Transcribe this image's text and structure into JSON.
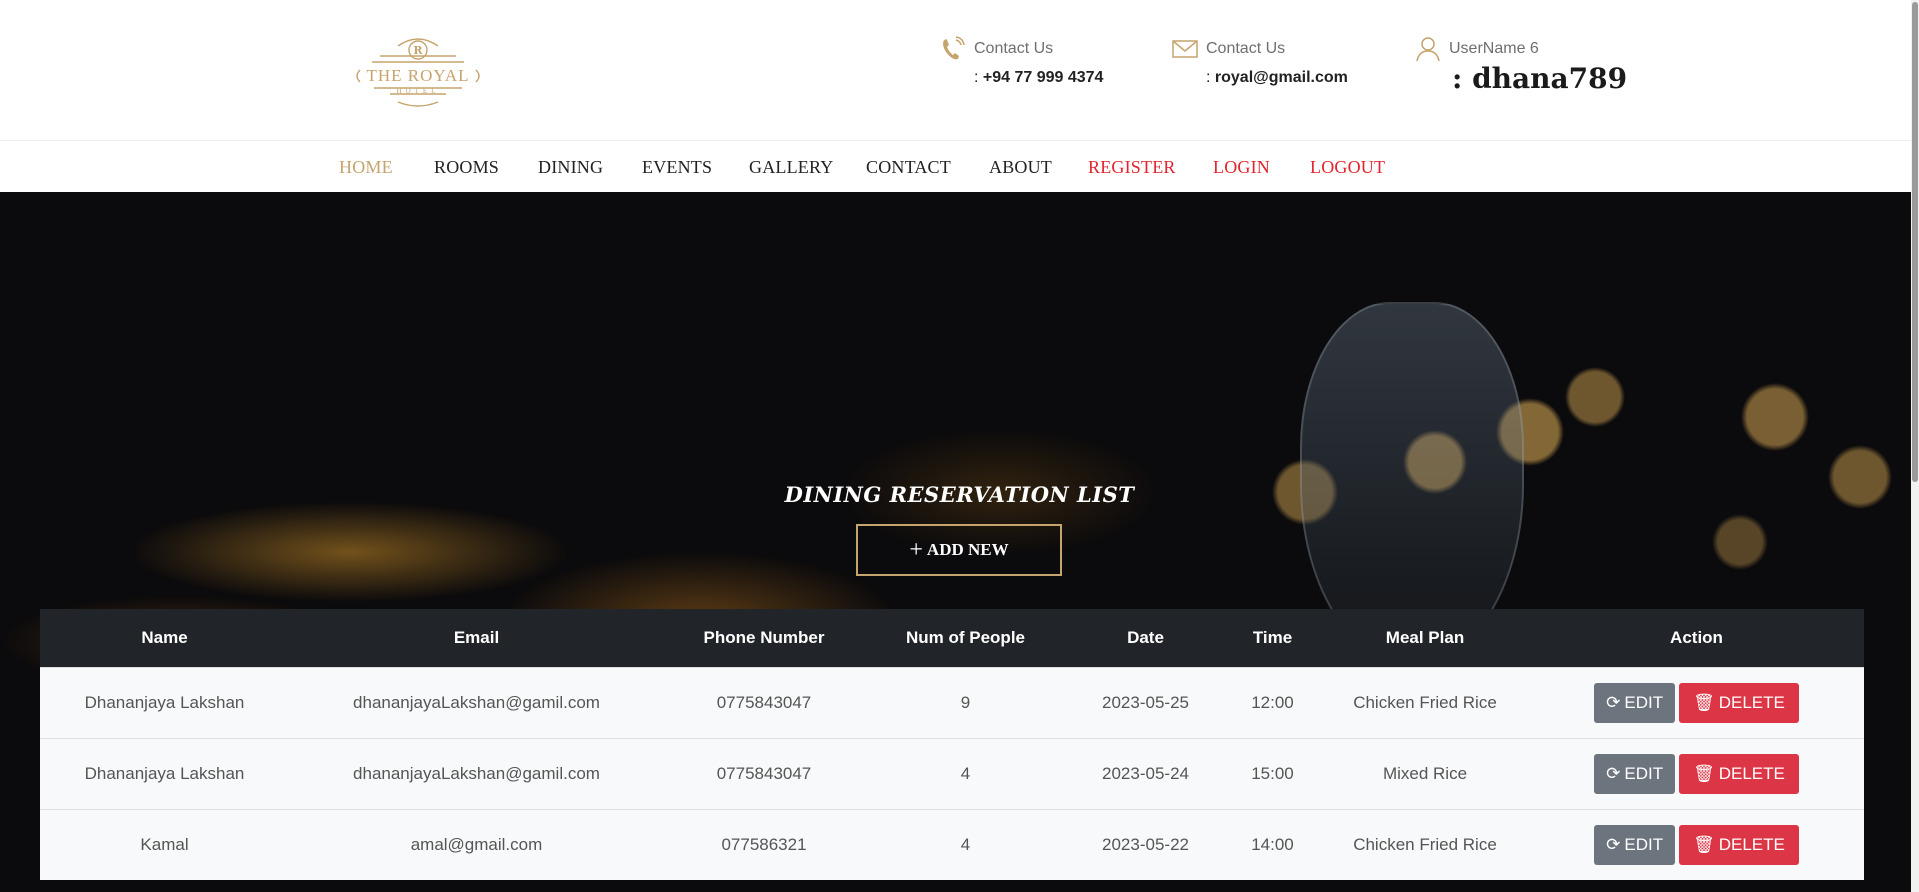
{
  "header": {
    "contact_phone": {
      "label": "Contact Us",
      "prefix": ": ",
      "value": "+94 77 999 4374",
      "icon": "phone-icon"
    },
    "contact_email": {
      "label": "Contact Us",
      "prefix": ": ",
      "value": "royal@gmail.com",
      "icon": "mail-icon"
    },
    "user": {
      "label": "UserName 6",
      "value": ": dhana789",
      "icon": "user-icon"
    },
    "logo": {
      "top": "R",
      "name": "THE ROYAL",
      "sub": "HOTEL"
    }
  },
  "nav": [
    {
      "label": "HOME",
      "state": "active"
    },
    {
      "label": "ROOMS"
    },
    {
      "label": "DINING"
    },
    {
      "label": "EVENTS"
    },
    {
      "label": "GALLERY"
    },
    {
      "label": "CONTACT"
    },
    {
      "label": "ABOUT"
    },
    {
      "label": "REGISTER",
      "color": "red"
    },
    {
      "label": "LOGIN",
      "color": "red"
    },
    {
      "label": "LOGOUT",
      "color": "red"
    }
  ],
  "hero": {
    "title": "DINING RESERVATION LIST",
    "add_button": "ADD NEW"
  },
  "table": {
    "columns": [
      "Name",
      "Email",
      "Phone Number",
      "Num of People",
      "Date",
      "Time",
      "Meal Plan",
      "Action"
    ],
    "rows": [
      {
        "name": "Dhananjaya Lakshan",
        "email": "dhananjayaLakshan@gamil.com",
        "phone": "0775843047",
        "people": "9",
        "date": "2023-05-25",
        "time": "12:00",
        "meal": "Chicken Fried Rice"
      },
      {
        "name": "Dhananjaya Lakshan",
        "email": "dhananjayaLakshan@gamil.com",
        "phone": "0775843047",
        "people": "4",
        "date": "2023-05-24",
        "time": "15:00",
        "meal": "Mixed Rice"
      },
      {
        "name": "Kamal",
        "email": "amal@gmail.com",
        "phone": "077586321",
        "people": "4",
        "date": "2023-05-22",
        "time": "14:00",
        "meal": "Chicken Fried Rice"
      }
    ],
    "edit_label": "EDIT",
    "delete_label": "DELETE"
  },
  "colors": {
    "accent": "#c5a46d",
    "danger": "#dc3545",
    "secondary": "#6c757d",
    "table_head": "#212529",
    "nav_red": "#e3232d"
  }
}
